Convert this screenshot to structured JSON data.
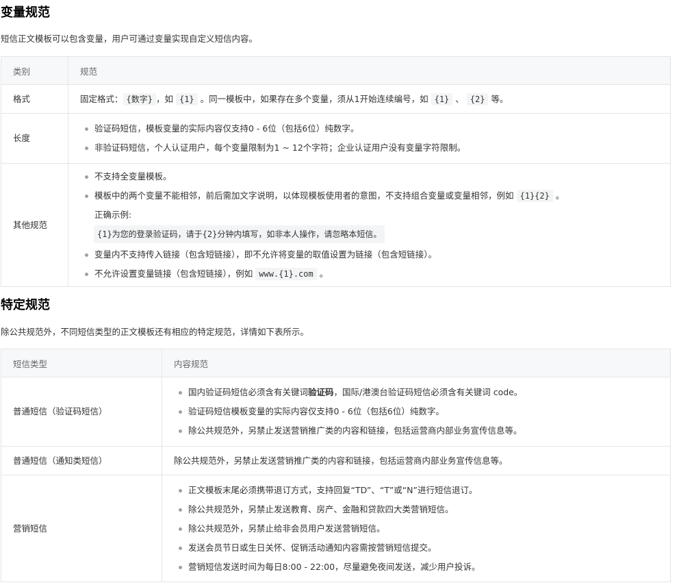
{
  "section1": {
    "title": "变量规范",
    "intro": "短信正文模板可以包含变量，用户可通过变量实现自定义短信内容。",
    "headers": [
      "类别",
      "规范"
    ],
    "format_label": "格式",
    "format": {
      "p1": "固定格式：",
      "c1": "{数字}",
      "p2": "，如",
      "c2": "{1}",
      "p3": "。同一模板中，如果存在多个变量，须从1开始连续编号，如",
      "c3": "{1}",
      "p4": "、",
      "c4": "{2}",
      "p5": "等。"
    },
    "length_label": "长度",
    "length_items": [
      "验证码短信，模板变量的实际内容仅支持0 - 6位（包括6位）纯数字。",
      "非验证码短信，个人认证用户，每个变量限制为1 ~ 12个字符；企业认证用户没有变量字符限制。"
    ],
    "other_label": "其他规范",
    "other": {
      "item1": "不支持全变量模板。",
      "item2_text": "模板中的两个变量不能相邻，前后需加文字说明，以体现模板使用者的意图，不支持组合变量或变量相邻，例如",
      "item2_code": "{1}{2}",
      "item2_end": "。",
      "example_label": "正确示例:",
      "example_code": "{1}为您的登录验证码，请于{2}分钟内填写，如非本人操作，请忽略本短信。",
      "item3": "变量内不支持传入链接（包含短链接），即不允许将变量的取值设置为链接（包含短链接）。",
      "item4_text": "不允许设置变量链接（包含短链接），例如",
      "item4_code": "www.{1}.com",
      "item4_end": "。"
    }
  },
  "section2": {
    "title": "特定规范",
    "intro": "除公共规范外，不同短信类型的正文模板还有相应的特定规范，详情如下表所示。",
    "headers": [
      "短信类型",
      "内容规范"
    ],
    "row1_label": "普通短信（验证码短信）",
    "row1": {
      "item1_pre": "国内验证码短信必须含有关键词",
      "item1_bold": "验证码",
      "item1_post": "，国际/港澳台验证码短信必须含有关键词 code。",
      "item2": "验证码短信模板变量的实际内容仅支持0 - 6位（包括6位）纯数字。",
      "item3": "除公共规范外，另禁止发送营销推广类的内容和链接，包括运营商内部业务宣传信息等。"
    },
    "row2_label": "普通短信（通知类短信）",
    "row2_text": "除公共规范外，另禁止发送营销推广类的内容和链接，包括运营商内部业务宣传信息等。",
    "row3_label": "营销短信",
    "row3_items": [
      "正文模板末尾必须携带退订方式，支持回复“TD”、“T”或“N”进行短信退订。",
      "除公共规范外，另禁止发送教育、房产、金融和贷款四大类营销短信。",
      "除公共规范外，另禁止给非会员用户发送营销短信。",
      "发送会员节日或生日关怀、促销活动通知内容需按营销短信提交。",
      "营销短信发送时间为每日8:00 - 22:00，尽量避免夜间发送，减少用户投诉。"
    ]
  }
}
